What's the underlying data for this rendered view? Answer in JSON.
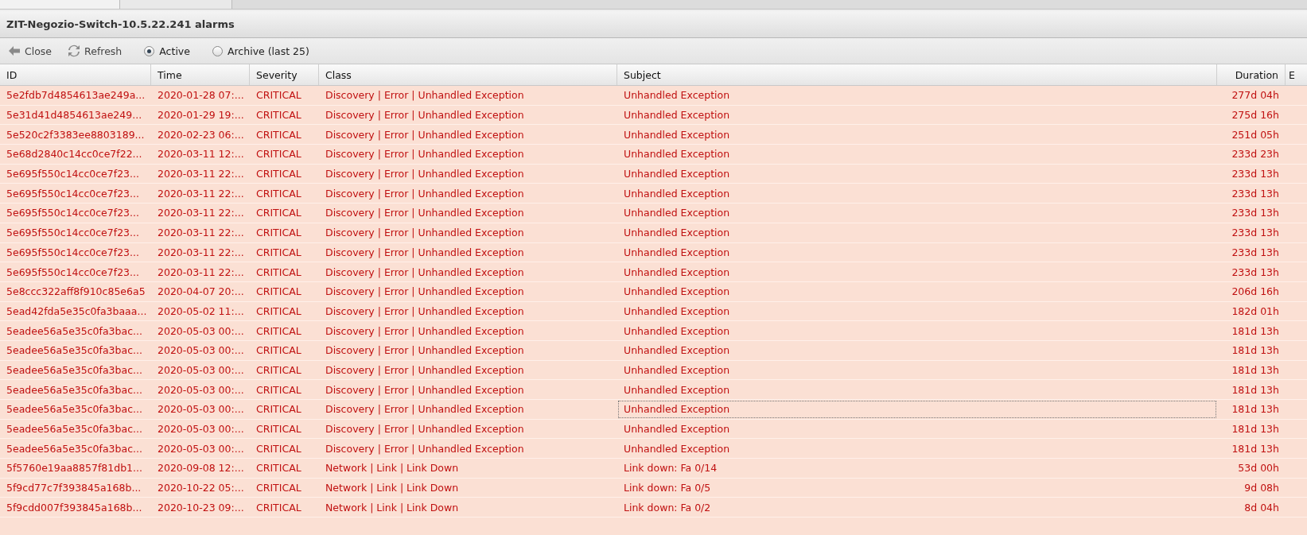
{
  "window": {
    "title": "ZIT-Negozio-Switch-10.5.22.241 alarms"
  },
  "toolbar": {
    "buttons": [
      {
        "label": "Close",
        "kind": "close"
      },
      {
        "label": "Refresh",
        "kind": "refresh"
      }
    ],
    "radios": [
      {
        "label": "Active",
        "selected": true
      },
      {
        "label": "Archive (last 25)",
        "selected": false
      }
    ]
  },
  "table": {
    "columns": [
      {
        "label": "ID"
      },
      {
        "label": "Time"
      },
      {
        "label": "Severity"
      },
      {
        "label": "Class"
      },
      {
        "label": "Subject"
      },
      {
        "label": "Duration"
      },
      {
        "label": "E"
      }
    ],
    "rows": [
      {
        "cells": [
          "5e2fdb7d4854613ae249a...",
          "2020-01-28 07:...",
          "CRITICAL",
          "Discovery | Error | Unhandled Exception",
          "Unhandled Exception",
          "277d 04h"
        ],
        "focused": false
      },
      {
        "cells": [
          "5e31d41d4854613ae249...",
          "2020-01-29 19:...",
          "CRITICAL",
          "Discovery | Error | Unhandled Exception",
          "Unhandled Exception",
          "275d 16h"
        ],
        "focused": false
      },
      {
        "cells": [
          "5e520c2f3383ee8803189...",
          "2020-02-23 06:...",
          "CRITICAL",
          "Discovery | Error | Unhandled Exception",
          "Unhandled Exception",
          "251d 05h"
        ],
        "focused": false
      },
      {
        "cells": [
          "5e68d2840c14cc0ce7f22...",
          "2020-03-11 12:...",
          "CRITICAL",
          "Discovery | Error | Unhandled Exception",
          "Unhandled Exception",
          "233d 23h"
        ],
        "focused": false
      },
      {
        "cells": [
          "5e695f550c14cc0ce7f23...",
          "2020-03-11 22:...",
          "CRITICAL",
          "Discovery | Error | Unhandled Exception",
          "Unhandled Exception",
          "233d 13h"
        ],
        "focused": false
      },
      {
        "cells": [
          "5e695f550c14cc0ce7f23...",
          "2020-03-11 22:...",
          "CRITICAL",
          "Discovery | Error | Unhandled Exception",
          "Unhandled Exception",
          "233d 13h"
        ],
        "focused": false
      },
      {
        "cells": [
          "5e695f550c14cc0ce7f23...",
          "2020-03-11 22:...",
          "CRITICAL",
          "Discovery | Error | Unhandled Exception",
          "Unhandled Exception",
          "233d 13h"
        ],
        "focused": false
      },
      {
        "cells": [
          "5e695f550c14cc0ce7f23...",
          "2020-03-11 22:...",
          "CRITICAL",
          "Discovery | Error | Unhandled Exception",
          "Unhandled Exception",
          "233d 13h"
        ],
        "focused": false
      },
      {
        "cells": [
          "5e695f550c14cc0ce7f23...",
          "2020-03-11 22:...",
          "CRITICAL",
          "Discovery | Error | Unhandled Exception",
          "Unhandled Exception",
          "233d 13h"
        ],
        "focused": false
      },
      {
        "cells": [
          "5e695f550c14cc0ce7f23...",
          "2020-03-11 22:...",
          "CRITICAL",
          "Discovery | Error | Unhandled Exception",
          "Unhandled Exception",
          "233d 13h"
        ],
        "focused": false
      },
      {
        "cells": [
          "5e8ccc322aff8f910c85e6a5",
          "2020-04-07 20:...",
          "CRITICAL",
          "Discovery | Error | Unhandled Exception",
          "Unhandled Exception",
          "206d 16h"
        ],
        "focused": false
      },
      {
        "cells": [
          "5ead42fda5e35c0fa3baaa...",
          "2020-05-02 11:...",
          "CRITICAL",
          "Discovery | Error | Unhandled Exception",
          "Unhandled Exception",
          "182d 01h"
        ],
        "focused": false
      },
      {
        "cells": [
          "5eadee56a5e35c0fa3bac...",
          "2020-05-03 00:...",
          "CRITICAL",
          "Discovery | Error | Unhandled Exception",
          "Unhandled Exception",
          "181d 13h"
        ],
        "focused": false
      },
      {
        "cells": [
          "5eadee56a5e35c0fa3bac...",
          "2020-05-03 00:...",
          "CRITICAL",
          "Discovery | Error | Unhandled Exception",
          "Unhandled Exception",
          "181d 13h"
        ],
        "focused": false
      },
      {
        "cells": [
          "5eadee56a5e35c0fa3bac...",
          "2020-05-03 00:...",
          "CRITICAL",
          "Discovery | Error | Unhandled Exception",
          "Unhandled Exception",
          "181d 13h"
        ],
        "focused": false
      },
      {
        "cells": [
          "5eadee56a5e35c0fa3bac...",
          "2020-05-03 00:...",
          "CRITICAL",
          "Discovery | Error | Unhandled Exception",
          "Unhandled Exception",
          "181d 13h"
        ],
        "focused": false
      },
      {
        "cells": [
          "5eadee56a5e35c0fa3bac...",
          "2020-05-03 00:...",
          "CRITICAL",
          "Discovery | Error | Unhandled Exception",
          "Unhandled Exception",
          "181d 13h"
        ],
        "focused": true
      },
      {
        "cells": [
          "5eadee56a5e35c0fa3bac...",
          "2020-05-03 00:...",
          "CRITICAL",
          "Discovery | Error | Unhandled Exception",
          "Unhandled Exception",
          "181d 13h"
        ],
        "focused": false
      },
      {
        "cells": [
          "5eadee56a5e35c0fa3bac...",
          "2020-05-03 00:...",
          "CRITICAL",
          "Discovery | Error | Unhandled Exception",
          "Unhandled Exception",
          "181d 13h"
        ],
        "focused": false
      },
      {
        "cells": [
          "5f5760e19aa8857f81db1...",
          "2020-09-08 12:...",
          "CRITICAL",
          "Network | Link | Link Down",
          "Link down: Fa 0/14",
          "53d 00h"
        ],
        "focused": false
      },
      {
        "cells": [
          "5f9cd77c7f393845a168b...",
          "2020-10-22 05:...",
          "CRITICAL",
          "Network | Link | Link Down",
          "Link down: Fa 0/5",
          "9d 08h"
        ],
        "focused": false
      },
      {
        "cells": [
          "5f9cdd007f393845a168b...",
          "2020-10-23 09:...",
          "CRITICAL",
          "Network | Link | Link Down",
          "Link down: Fa 0/2",
          "8d 04h"
        ],
        "focused": false
      }
    ]
  }
}
